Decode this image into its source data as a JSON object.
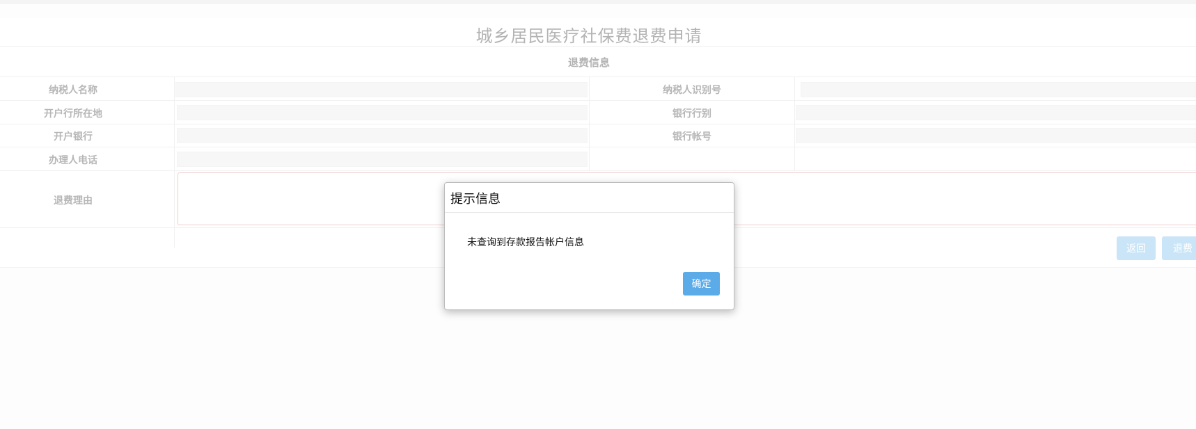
{
  "form": {
    "title": "城乡居民医疗社保费退费申请",
    "section_title": "退费信息",
    "labels": {
      "taxpayer_name": "纳税人名称",
      "taxpayer_id": "纳税人识别号",
      "bank_location": "开户行所在地",
      "bank_type": "银行行别",
      "bank_name": "开户银行",
      "bank_account": "银行帐号",
      "handler_phone": "办理人电话",
      "refund_reason": "退费理由"
    },
    "values": {
      "taxpayer_name": "",
      "taxpayer_id": "",
      "bank_location": "",
      "bank_type": "",
      "bank_name": "",
      "bank_account": "",
      "handler_phone": "",
      "refund_reason": ""
    },
    "buttons": {
      "back": "返回",
      "refund": "退费"
    }
  },
  "dialog": {
    "title": "提示信息",
    "message": "未查询到存款报告帐户信息",
    "confirm": "确定"
  },
  "colors": {
    "confirm_button": "#5aabe8",
    "disabled_button": "#b8dcf4",
    "label_text": "#9e9e9e"
  }
}
